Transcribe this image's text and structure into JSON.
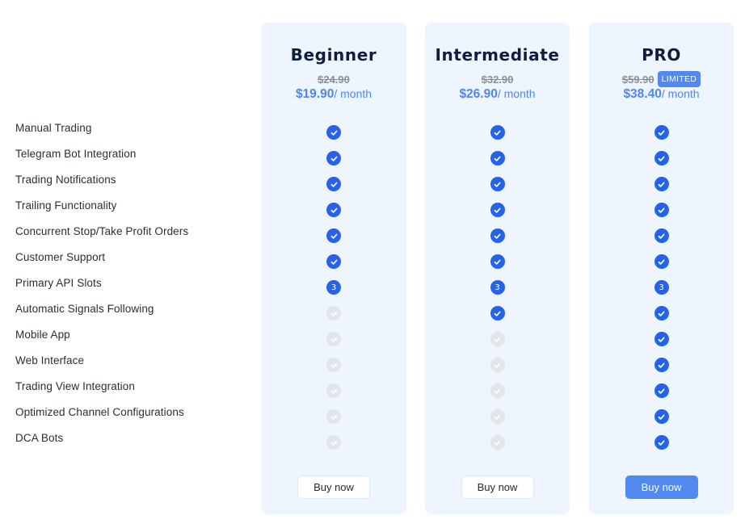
{
  "features": [
    "Manual Trading",
    "Telegram Bot Integration",
    "Trading Notifications",
    "Trailing Functionality",
    "Concurrent Stop/Take Profit Orders",
    "Customer Support",
    "Primary API Slots",
    "Automatic Signals Following",
    "Mobile App",
    "Web Interface",
    "Trading View Integration",
    "Optimized Channel Configurations",
    "DCA Bots"
  ],
  "plans": [
    {
      "name": "Beginner",
      "old_price": "$24.90",
      "badge": "",
      "price": "$19.90",
      "period": "/ month",
      "button_label": "Buy now",
      "primary": false,
      "features": [
        "check",
        "check",
        "check",
        "check",
        "check",
        "check",
        "3",
        "none",
        "none",
        "none",
        "none",
        "none",
        "none"
      ]
    },
    {
      "name": "Intermediate",
      "old_price": "$32.90",
      "badge": "",
      "price": "$26.90",
      "period": "/ month",
      "button_label": "Buy now",
      "primary": false,
      "features": [
        "check",
        "check",
        "check",
        "check",
        "check",
        "check",
        "3",
        "check",
        "none",
        "none",
        "none",
        "none",
        "none"
      ]
    },
    {
      "name": "PRO",
      "old_price": "$59.90",
      "badge": "LIMITED",
      "price": "$38.40",
      "period": "/ month",
      "button_label": "Buy now",
      "primary": true,
      "features": [
        "check",
        "check",
        "check",
        "check",
        "check",
        "check",
        "3",
        "check",
        "check",
        "check",
        "check",
        "check",
        "check"
      ]
    }
  ],
  "colors": {
    "accent": "#2563eb",
    "price": "#4f86ee",
    "card_bg": "#eef5fe",
    "disabled": "#e3e5e8"
  }
}
